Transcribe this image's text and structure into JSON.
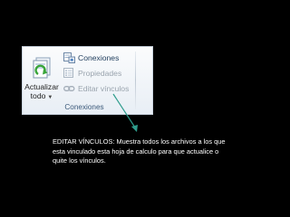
{
  "ribbon": {
    "refresh_button": {
      "label_line1": "Actualizar",
      "label_line2": "todo",
      "icon": "refresh-all-icon"
    },
    "items": [
      {
        "label": "Conexiones",
        "icon": "connections-icon",
        "enabled": true
      },
      {
        "label": "Propiedades",
        "icon": "properties-icon",
        "enabled": false
      },
      {
        "label": "Editar vínculos",
        "icon": "edit-links-icon",
        "enabled": false
      }
    ],
    "group_label": "Conexiones"
  },
  "caption": {
    "text": "EDITAR VÍNCULOS: Muestra todos los archivos a los que esta vinculado esta hoja de calculo para que actualice o quite los vínculos."
  },
  "colors": {
    "background": "#000000",
    "arrow": "#2e9c8c",
    "caption_text": "#ffffff"
  }
}
